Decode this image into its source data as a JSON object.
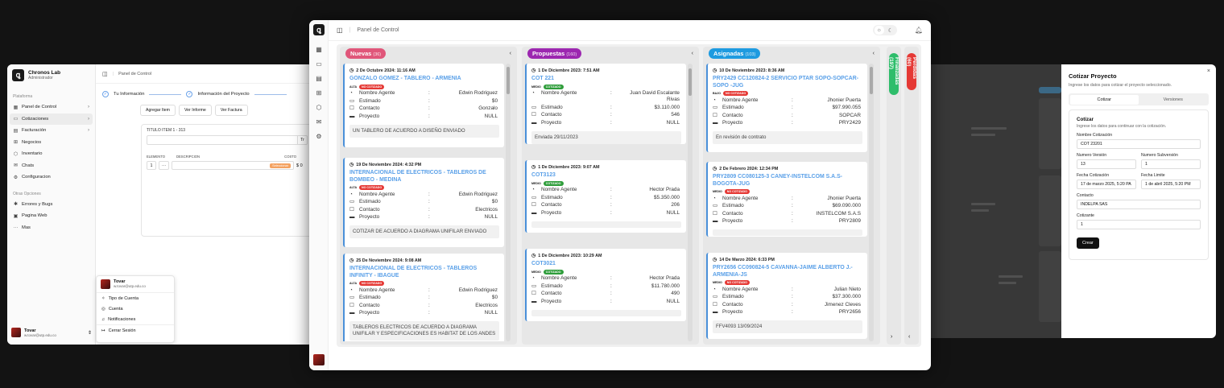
{
  "left": {
    "brand": {
      "title": "Chronos Lab",
      "subtitle": "Administrador"
    },
    "groups": {
      "platform": "Plataforma",
      "others": "Otras Opciones"
    },
    "nav": [
      {
        "label": "Panel de Control",
        "icon": "dashboard-icon",
        "chev": "›"
      },
      {
        "label": "Cotizaciones",
        "icon": "folder-icon",
        "chev": "›"
      },
      {
        "label": "Facturación",
        "icon": "invoice-icon",
        "chev": "›"
      },
      {
        "label": "Negocios",
        "icon": "grid-icon",
        "chev": ""
      },
      {
        "label": "Inventario",
        "icon": "box-icon",
        "chev": ""
      },
      {
        "label": "Chats",
        "icon": "chat-icon",
        "chev": ""
      },
      {
        "label": "Configuracion",
        "icon": "gear-icon",
        "chev": ""
      }
    ],
    "others": [
      {
        "label": "Errores y Bugs",
        "icon": "bug-icon"
      },
      {
        "label": "Pagina Web",
        "icon": "web-icon"
      },
      {
        "label": "Mas",
        "icon": "more-icon"
      }
    ],
    "topbar": "Panel de Control",
    "steps": {
      "one": "Tu Información",
      "two": "Información del Proyecto"
    },
    "buttons": {
      "add": "Agregar Item",
      "report": "Ver Informe",
      "invoice": "Ver Factura"
    },
    "form": {
      "item_label": "TITULO ITEM 1 - 313",
      "tr": "Tr",
      "h_element": "ELEMENTO",
      "h_desc": "DESCRIPCION",
      "h_cost": "COSTO",
      "qty": "1",
      "dots": "···",
      "select": "Seleccionar",
      "cost": "$ 0"
    },
    "user": {
      "name": "Tovar",
      "email": "w.tovar@utp.edu.co"
    },
    "menu": [
      "Tipo de Cuenta",
      "Cuenta",
      "Notificaciones",
      "Cerrar Sesión"
    ]
  },
  "center": {
    "topbar": "Panel de Control",
    "columns": [
      {
        "title": "Nuevas",
        "count": "(36)",
        "color": "#e0567a",
        "cards": [
          {
            "date": "2 De Octubre 2024: 11:16 AM",
            "title": "GONZALO GOMEZ - TABLERO - ARMENIA",
            "prio": "ALTA",
            "status": "NO COTIZADO",
            "statusColor": "#e53935",
            "agent": "Edwin Rodriguez",
            "estimate": "$0",
            "contact": "Gonzalo",
            "project": "NULL",
            "note": "UN TABLERO DE ACUERDO A DISEÑO ENVIADO"
          },
          {
            "date": "19 De Noviembre 2024: 4:32 PM",
            "title": "INTERNACIONAL DE ELECTRICOS - TABLEROS DE BOMBEO - MEDINA",
            "prio": "ALTA",
            "status": "NO COTIZADO",
            "statusColor": "#e53935",
            "agent": "Edwin Rodriguez",
            "estimate": "$0",
            "contact": "Electricos",
            "project": "NULL",
            "note": "COTIZAR DE ACUERDO A DIAGRAMA UNIFILAR ENVIADO"
          },
          {
            "date": "25 De Noviembre 2024: 9:08 AM",
            "title": "INTERNACIONAL DE ELECTRICOS - TABLEROS INFINITY - IBAGUE",
            "prio": "ALTA",
            "status": "NO COTIZADO",
            "statusColor": "#e53935",
            "agent": "Edwin Rodriguez",
            "estimate": "$0",
            "contact": "Electricos",
            "project": "NULL",
            "note": "TABLEROS ELECTRICOS DE ACUERDO A DIAGRAMA UNIFILAR Y ESPECIFICACIONES ES HABITAT DE LOS ANDES"
          }
        ]
      },
      {
        "title": "Propuestas",
        "count": "(160)",
        "color": "#9c27b0",
        "cards": [
          {
            "date": "1 De Diciembre 2023: 7:51 AM",
            "title": "COT 221",
            "prio": "MEDIO",
            "status": "COTIZADO",
            "statusColor": "#2e9d3a",
            "agent": "Juan David Escalante Rivas",
            "estimate": "$3.110.000",
            "contact": "546",
            "project": "NULL",
            "note": "Enviada 29/11/2023"
          },
          {
            "date": "1 De Diciembre 2023: 9:07 AM",
            "title": "COT3123",
            "prio": "MEDIO",
            "status": "COTIZADO",
            "statusColor": "#2e9d3a",
            "agent": "Hector Prada",
            "estimate": "$5.350.000",
            "contact": "206",
            "project": "NULL",
            "note": ""
          },
          {
            "date": "1 De Diciembre 2023: 10:29 AM",
            "title": "COT3021",
            "prio": "MEDIO",
            "status": "COTIZADO",
            "statusColor": "#2e9d3a",
            "agent": "Hector Prada",
            "estimate": "$11.780.000",
            "contact": "490",
            "project": "NULL",
            "note": ""
          }
        ]
      },
      {
        "title": "Asignadas",
        "count": "(103)",
        "color": "#1e9be0",
        "cards": [
          {
            "date": "10 De Noviembre 2023: 8:36 AM",
            "title": "PRY2429 CC120824-2 SERVICIO PTAR SOPO-SOPCAR-SOPO -JUG",
            "prio": "BAJO",
            "status": "NO COTIZADO",
            "statusColor": "#e53935",
            "agent": "Jhonier Puerta",
            "estimate": "$97.990.055",
            "contact": "SOPCAR",
            "project": "PRY2429",
            "note": "En revisión de contrato"
          },
          {
            "date": "2 De Febrero 2024: 12:34 PM",
            "title": "PRY2809 CC080125-3 CANEY-INSTELCOM S.A.S-BOGOTA-JUG",
            "prio": "MEDIO",
            "status": "NO COTIZADO",
            "statusColor": "#e53935",
            "agent": "Jhonier Puerta",
            "estimate": "$69.090.000",
            "contact": "INSTELCOM S.A.S",
            "project": "PRY2809",
            "note": ""
          },
          {
            "date": "14 De Marzo 2024: 6:33 PM",
            "title": "PRY2656 CC090824-5 CAVANNA-JAIME ALBERTO J.-ARMENIA-JS",
            "prio": "MEDIO",
            "status": "NO COTIZADO",
            "statusColor": "#e53935",
            "agent": "Julian Nieto",
            "estimate": "$37.300.000",
            "contact": "Jimenez Cleves",
            "project": "PRY2656",
            "note": "FFV4093 13/09/2024"
          }
        ]
      }
    ],
    "field_labels": {
      "agent": "Nombre Agente",
      "estimate": "Estimado",
      "contact": "Contacto",
      "project": "Proyecto"
    },
    "vertical": [
      {
        "title": "Finalizadas (197)",
        "color": "#2ebd6b"
      },
      {
        "title": "Perdidas (60)",
        "color": "#e53935"
      }
    ]
  },
  "right": {
    "title": "Cotizar Proyecto",
    "subtitle": "Ingrese los datos para cotizar el proyecto seleccionado.",
    "tabs": [
      "Cotizar",
      "Versiones"
    ],
    "card_title": "Cotizar",
    "card_sub": "Ingrese los datos para continuar con la cotización.",
    "fields": {
      "name_label": "Nombre Cotización",
      "name": "COT 23201",
      "ver_label": "Numero Versión",
      "ver": "13",
      "subver_label": "Numero Subversión",
      "subver": "1",
      "date_label": "Fecha Cotización",
      "date": "17 de marzo 2025, 5:20 PA",
      "limit_label": "Fecha Limite",
      "limit": "1 de abril 2025, 5:20 PM",
      "contact_label": "Contacto",
      "contact": "INDELPA SAS",
      "quoter_label": "Cotizante",
      "quoter": "1"
    },
    "button": "Crear",
    "close": "×"
  }
}
